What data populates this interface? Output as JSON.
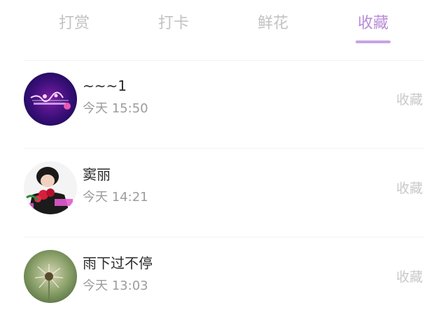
{
  "tabs": [
    {
      "label": "打赏"
    },
    {
      "label": "打卡"
    },
    {
      "label": "鲜花"
    },
    {
      "label": "收藏",
      "active": true
    }
  ],
  "colors": {
    "accent": "#b98bd8",
    "inactive_tab": "#c2c2c2",
    "time_text": "#9c9c9c",
    "action_text": "#c9c9c9"
  },
  "records": [
    {
      "name": "~~~1",
      "time": "今天 15:50",
      "action": "收藏",
      "avatar_icon": "purple-logo-avatar"
    },
    {
      "name": "窦丽",
      "time": "今天 14:21",
      "action": "收藏",
      "avatar_icon": "girl-with-roses-avatar"
    },
    {
      "name": "雨下过不停",
      "time": "今天 13:03",
      "action": "收藏",
      "avatar_icon": "dandelion-avatar"
    }
  ]
}
